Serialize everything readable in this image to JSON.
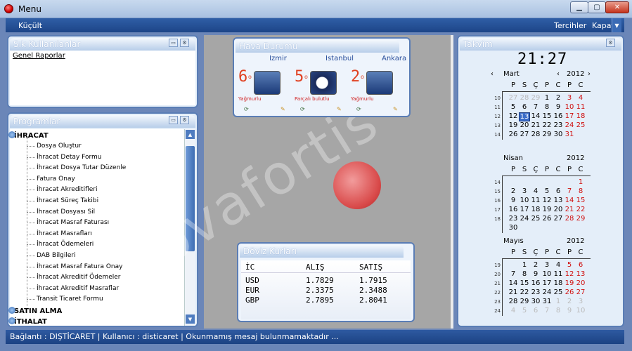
{
  "window": {
    "title": "Menu"
  },
  "menubar": {
    "left": "Küçült",
    "right1": "Tercihler",
    "right2": "Kapat"
  },
  "favorites": {
    "title": "Sık Kullanılanlar",
    "items": [
      "Genel Raporlar"
    ]
  },
  "programs": {
    "title": "Programlar",
    "groups": [
      "İHRACAT",
      "SATIN ALMA",
      "İTHALAT"
    ],
    "items": [
      "Dosya Oluştur",
      "İhracat Detay Formu",
      "İhracat Dosya Tutar Düzenle",
      "Fatura Onay",
      "İhracat Akreditifleri",
      "İhracat Süreç Takibi",
      "İhracat Dosyası Sil",
      "İhracat Masraf Faturası",
      "İhracat Masrafları",
      "İhracat Ödemeleri",
      "DAB Bilgileri",
      "İhracat Masraf Fatura Onay",
      "İhracat Akreditif Ödemeler",
      "İhracat Akreditif Masraflar",
      "Transit Ticaret Formu"
    ]
  },
  "weather": {
    "title": "Hava Durumu",
    "cities": [
      {
        "name": "Izmir",
        "temp": "6",
        "unit": "o",
        "desc": "Yağmurlu"
      },
      {
        "name": "Istanbul",
        "temp": "5",
        "unit": "o",
        "desc": "Parçalı bulutlu"
      },
      {
        "name": "Ankara",
        "temp": "2",
        "unit": "o",
        "desc": "Yağmurlu"
      }
    ]
  },
  "fx": {
    "title": "Döviz Kurları",
    "headers": [
      "İC",
      "ALIŞ",
      "SATIŞ"
    ],
    "rows": [
      [
        "USD",
        "1.7829",
        "1.7915"
      ],
      [
        "EUR",
        "2.3375",
        "2.3488"
      ],
      [
        "GBP",
        "2.7895",
        "2.8041"
      ]
    ]
  },
  "calendar": {
    "title": "Takvim",
    "clock": "21:27",
    "dow": [
      "P",
      "S",
      "Ç",
      "P",
      "C",
      "P",
      "C"
    ],
    "months": [
      {
        "name": "Mart",
        "year": "2012",
        "weeks": [
          "10",
          "11",
          "12",
          "13",
          "14"
        ],
        "rows": [
          [
            "27",
            "28",
            "29",
            "1",
            "2",
            "3",
            "4"
          ],
          [
            "5",
            "6",
            "7",
            "8",
            "9",
            "10",
            "11"
          ],
          [
            "12",
            "13",
            "14",
            "15",
            "16",
            "17",
            "18"
          ],
          [
            "19",
            "20",
            "21",
            "22",
            "23",
            "24",
            "25"
          ],
          [
            "26",
            "27",
            "28",
            "29",
            "30",
            "31",
            ""
          ]
        ]
      },
      {
        "name": "Nisan",
        "year": "2012",
        "weeks": [
          "14",
          "15",
          "16",
          "17",
          "18"
        ],
        "rows": [
          [
            "",
            "",
            "",
            "",
            "",
            "",
            "1"
          ],
          [
            "2",
            "3",
            "4",
            "5",
            "6",
            "7",
            "8"
          ],
          [
            "9",
            "10",
            "11",
            "12",
            "13",
            "14",
            "15"
          ],
          [
            "16",
            "17",
            "18",
            "19",
            "20",
            "21",
            "22"
          ],
          [
            "23",
            "24",
            "25",
            "26",
            "27",
            "28",
            "29"
          ],
          [
            "30",
            "",
            "",
            "",
            "",
            "",
            ""
          ]
        ]
      },
      {
        "name": "Mayıs",
        "year": "2012",
        "weeks": [
          "19",
          "20",
          "21",
          "22",
          "23",
          "24"
        ],
        "rows": [
          [
            "",
            "1",
            "2",
            "3",
            "4",
            "5",
            "6"
          ],
          [
            "7",
            "8",
            "9",
            "10",
            "11",
            "12",
            "13"
          ],
          [
            "14",
            "15",
            "16",
            "17",
            "18",
            "19",
            "20"
          ],
          [
            "21",
            "22",
            "23",
            "24",
            "25",
            "26",
            "27"
          ],
          [
            "28",
            "29",
            "30",
            "31",
            "1",
            "2",
            "3"
          ],
          [
            "4",
            "5",
            "6",
            "7",
            "8",
            "9",
            "10"
          ]
        ]
      }
    ]
  },
  "status": {
    "text": "Bağlantı : DIŞTİCARET  |  Kullanıcı : disticaret  |  Okunmamış mesaj bulunmamaktadır ..."
  },
  "watermark": {
    "text": "novafortis"
  }
}
